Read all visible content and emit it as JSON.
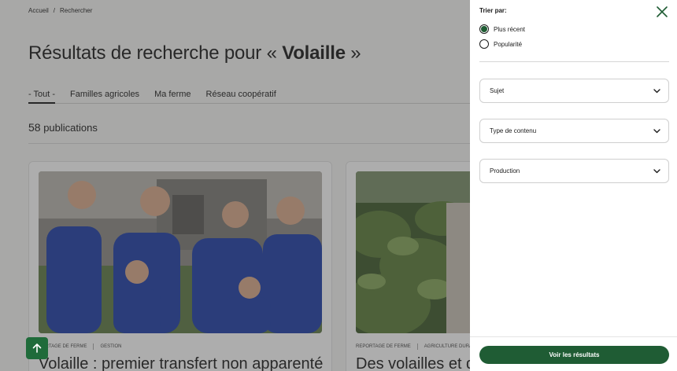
{
  "breadcrumb": {
    "home": "Accueil",
    "separator": "/",
    "current": "Rechercher"
  },
  "page": {
    "title_prefix": "Résultats de recherche pour « ",
    "query": "Volaille",
    "title_suffix": " »"
  },
  "tabs": [
    {
      "label": "- Tout -",
      "active": true
    },
    {
      "label": "Familles agricoles",
      "active": false
    },
    {
      "label": "Ma ferme",
      "active": false
    },
    {
      "label": "Réseau coopératif",
      "active": false
    }
  ],
  "results": {
    "count": "58",
    "label": "publications"
  },
  "cards": [
    {
      "tag1": "PORTAGE DE FERME",
      "tag2": "GESTION",
      "title": "Volaille : premier transfert non apparenté",
      "image": "family-photo"
    },
    {
      "tag1": "REPORTAGE DE FERME",
      "tag2": "AGRICULTURE DURABLE",
      "title": "Des volailles et de",
      "image": "strawberry-greenhouse-photo"
    }
  ],
  "filter_panel": {
    "sort_title": "Trier par:",
    "sort_options": [
      {
        "label": "Plus récent",
        "checked": true
      },
      {
        "label": "Popularité",
        "checked": false
      }
    ],
    "selects": [
      {
        "label": "Sujet"
      },
      {
        "label": "Type de contenu"
      },
      {
        "label": "Production"
      }
    ],
    "submit_label": "Voir les résultats"
  },
  "colors": {
    "brand_green": "#1f5c34",
    "scroll_button": "#1f6b3a",
    "overlay": "rgba(60,60,60,0.42)"
  },
  "icons": [
    "close-icon",
    "chevron-down-icon",
    "arrow-up-icon"
  ]
}
